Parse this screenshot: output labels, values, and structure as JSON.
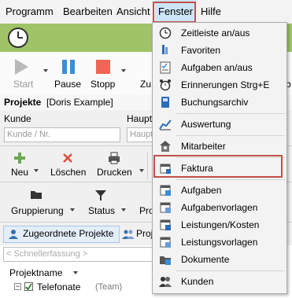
{
  "menubar": {
    "items": [
      "Programm",
      "Bearbeiten",
      "Ansicht",
      "Fenster",
      "Hilfe"
    ],
    "active": "Fenster"
  },
  "toolbar": {
    "start": "Start",
    "pause": "Pause",
    "stop": "Stopp",
    "zu": "Zu"
  },
  "projects": {
    "title": "Projekte",
    "subtitle": "[Doris Example]",
    "kunde_label": "Kunde",
    "kunde_placeholder": "Kunde / Nr.",
    "haupt_label": "Haupt",
    "haupt_placeholder": "Haupt"
  },
  "actions": {
    "neu": "Neu",
    "loeschen": "Löschen",
    "drucken": "Drucken"
  },
  "view_actions": {
    "gruppierung": "Gruppierung",
    "status": "Status",
    "pro": "Pro"
  },
  "tabs": {
    "assigned": "Zugeordnete Projekte",
    "proj": "Proj"
  },
  "quick_entry_placeholder": "< Schnellerfassung >",
  "list": {
    "column": "Projektname",
    "row_name": "Telefonate",
    "row_tag": "(Team)"
  },
  "fenster_menu": {
    "items": [
      {
        "label": "Zeitleiste an/aus",
        "icon": "clock-icon"
      },
      {
        "label": "Favoriten",
        "icon": "favorites-icon"
      },
      {
        "label": "Aufgaben an/aus",
        "icon": "tasks-icon"
      },
      {
        "label": "Erinnerungen Strg+E",
        "icon": "alarm-clock-icon"
      },
      {
        "label": "Buchungsarchiv",
        "icon": "archive-icon"
      },
      {
        "label": "Auswertung",
        "icon": "chart-icon"
      },
      {
        "label": "Mitarbeiter",
        "icon": "employees-icon"
      },
      {
        "label": "Faktura",
        "icon": "invoice-icon"
      },
      {
        "label": "Aufgaben",
        "icon": "task-list-icon"
      },
      {
        "label": "Aufgabenvorlagen",
        "icon": "task-template-icon"
      },
      {
        "label": "Leistungen/Kosten",
        "icon": "services-costs-icon"
      },
      {
        "label": "Leistungsvorlagen",
        "icon": "service-template-icon"
      },
      {
        "label": "Dokumente",
        "icon": "documents-icon"
      },
      {
        "label": "Kunden",
        "icon": "customers-icon"
      }
    ],
    "highlighted": "Faktura"
  },
  "colors": {
    "green_bar": "#9fc467",
    "menu_highlight": "#cde6f7",
    "annotation_red": "#c0504d"
  }
}
